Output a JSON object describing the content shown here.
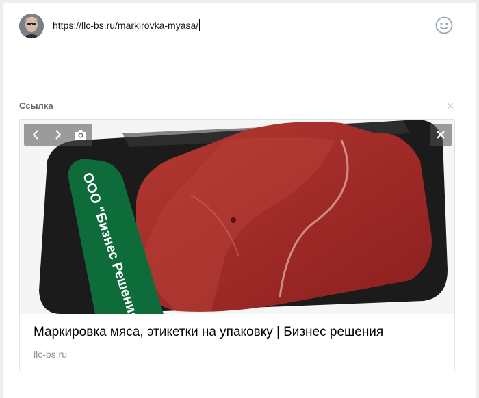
{
  "composer": {
    "input_value": "https://llc-bs.ru/markirovka-myasa/"
  },
  "attachment": {
    "section_label": "Ссылка",
    "close_symbol": "×",
    "image_label_text": "ООО \"Бизнес Решения\"",
    "title": "Маркировка мяса, этикетки на упаковку | Бизнес решения",
    "domain": "llc-bs.ru"
  },
  "icons": {
    "emoji": "smile-icon",
    "prev": "chevron-left-icon",
    "next": "chevron-right-icon",
    "camera": "camera-icon",
    "remove": "close-icon"
  },
  "colors": {
    "label_green": "#0e6b3a",
    "meat_red": "#a8312b",
    "tray_black": "#1b1b1b"
  }
}
